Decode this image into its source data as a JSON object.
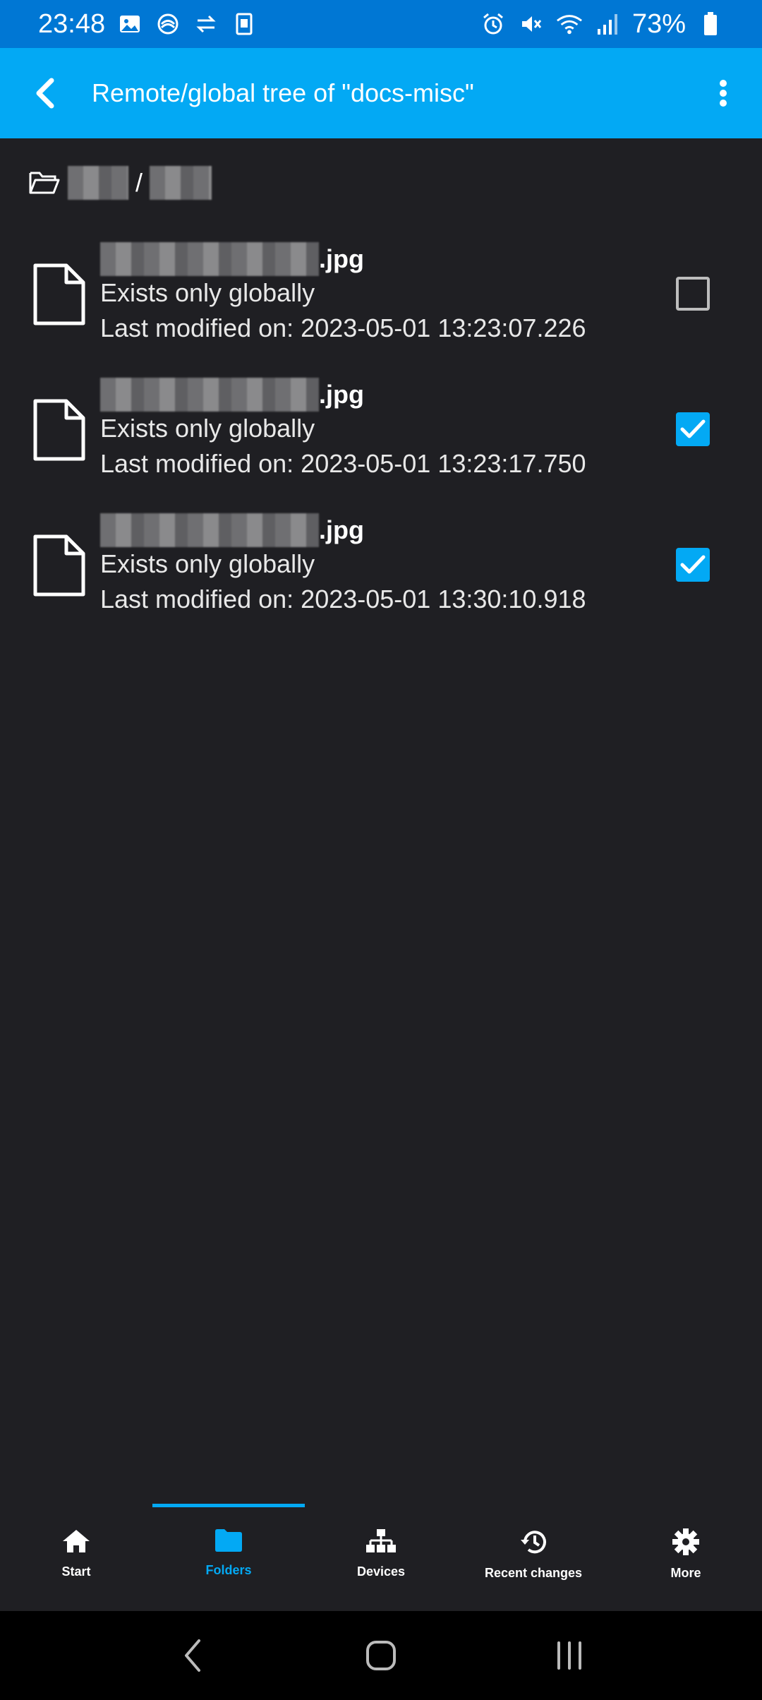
{
  "status_bar": {
    "time": "23:48",
    "battery": "73%",
    "left_icons": [
      "image-icon",
      "sync-icon",
      "transfer-icon",
      "app-icon"
    ],
    "right_icons": [
      "alarm-icon",
      "mute-icon",
      "wifi-icon",
      "signal-icon",
      "battery-icon"
    ]
  },
  "app_bar": {
    "title": "Remote/global tree of \"docs-misc\"",
    "back_icon": "chevron-left-icon",
    "menu_icon": "more-vert-icon"
  },
  "breadcrumb": {
    "separator": "/",
    "icon": "folder-open-icon"
  },
  "files": [
    {
      "ext": ".jpg",
      "status": "Exists only globally",
      "modified": "Last modified on: 2023-05-01 13:23:07.226",
      "checked": false
    },
    {
      "ext": ".jpg",
      "status": "Exists only globally",
      "modified": "Last modified on: 2023-05-01 13:23:17.750",
      "checked": true
    },
    {
      "ext": ".jpg",
      "status": "Exists only globally",
      "modified": "Last modified on: 2023-05-01 13:30:10.918",
      "checked": true
    }
  ],
  "bottom_nav": {
    "items": [
      {
        "label": "Start",
        "icon": "home-icon"
      },
      {
        "label": "Folders",
        "icon": "folder-icon"
      },
      {
        "label": "Devices",
        "icon": "devices-icon"
      },
      {
        "label": "Recent changes",
        "icon": "history-icon"
      },
      {
        "label": "More",
        "icon": "gear-icon"
      }
    ],
    "active": "Folders"
  },
  "colors": {
    "status_bar": "#0077d4",
    "app_bar": "#03a9f4",
    "background": "#1f1f23",
    "accent": "#03a9f4"
  }
}
